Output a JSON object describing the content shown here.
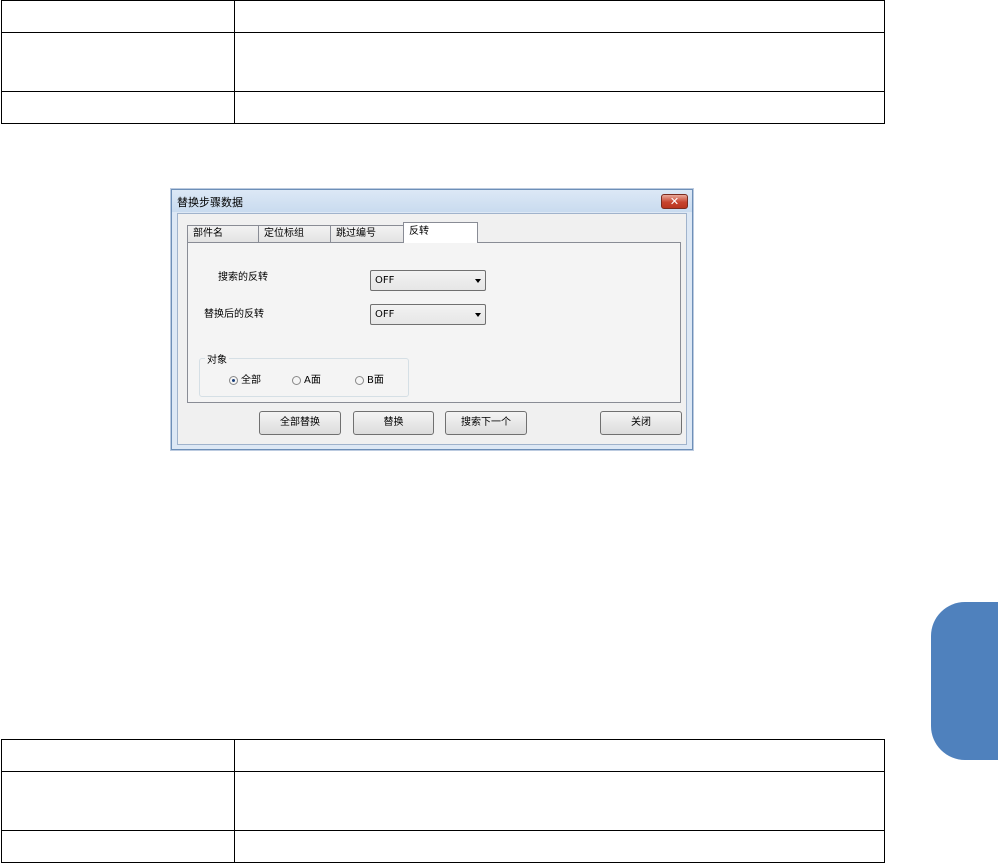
{
  "dialog": {
    "title": "替换步骤数据",
    "close_glyph": "✕",
    "tabs": [
      {
        "label": "部件名"
      },
      {
        "label": "定位标组"
      },
      {
        "label": "跳过编号"
      },
      {
        "label": "反转"
      }
    ],
    "active_tab": "反转",
    "search_flip": {
      "label": "搜索的反转",
      "value": "OFF"
    },
    "replace_flip": {
      "label": "替换后的反转",
      "value": "OFF"
    },
    "target": {
      "title": "对象",
      "options": [
        {
          "label": "全部",
          "selected": true
        },
        {
          "label": "A面",
          "selected": false
        },
        {
          "label": "B面",
          "selected": false
        }
      ]
    },
    "buttons": {
      "replace_all": "全部替换",
      "replace": "替换",
      "search_next": "搜索下一个",
      "close": "关闭"
    }
  },
  "colors": {
    "side_tab": "#4f81bd",
    "title_bar": "#c9dbef",
    "close_button": "#c7432e"
  }
}
